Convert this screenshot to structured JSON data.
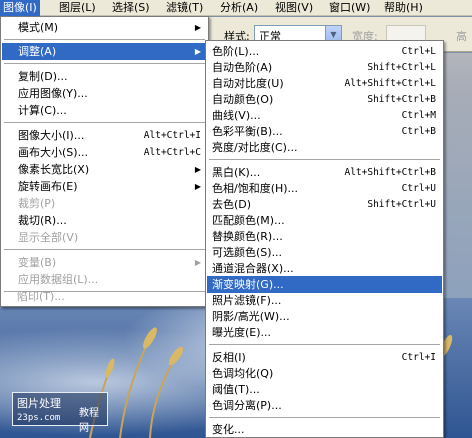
{
  "menubar": {
    "items": [
      "图像(I)",
      "图层(L)",
      "选择(S)",
      "滤镜(T)",
      "分析(A)",
      "视图(V)",
      "窗口(W)",
      "帮助(H)"
    ]
  },
  "options_bar": {
    "style_label": "样式:",
    "style_value": "正常",
    "width_label": "宽度:",
    "height_label": "高"
  },
  "image_menu": {
    "items": [
      {
        "label": "模式(M)",
        "shortcut": "",
        "submenu": true,
        "disabled": false,
        "highlighted": false
      },
      {
        "label": "调整(A)",
        "shortcut": "",
        "submenu": true,
        "disabled": false,
        "highlighted": true
      },
      {
        "label": "复制(D)...",
        "shortcut": "",
        "submenu": false,
        "disabled": false,
        "highlighted": false
      },
      {
        "label": "应用图像(Y)...",
        "shortcut": "",
        "submenu": false,
        "disabled": false,
        "highlighted": false
      },
      {
        "label": "计算(C)...",
        "shortcut": "",
        "submenu": false,
        "disabled": false,
        "highlighted": false
      },
      {
        "label": "图像大小(I)...",
        "shortcut": "Alt+Ctrl+I",
        "submenu": false,
        "disabled": false,
        "highlighted": false
      },
      {
        "label": "画布大小(S)...",
        "shortcut": "Alt+Ctrl+C",
        "submenu": false,
        "disabled": false,
        "highlighted": false
      },
      {
        "label": "像素长宽比(X)",
        "shortcut": "",
        "submenu": true,
        "disabled": false,
        "highlighted": false
      },
      {
        "label": "旋转画布(E)",
        "shortcut": "",
        "submenu": true,
        "disabled": false,
        "highlighted": false
      },
      {
        "label": "裁剪(P)",
        "shortcut": "",
        "submenu": false,
        "disabled": true,
        "highlighted": false
      },
      {
        "label": "裁切(R)...",
        "shortcut": "",
        "submenu": false,
        "disabled": false,
        "highlighted": false
      },
      {
        "label": "显示全部(V)",
        "shortcut": "",
        "submenu": false,
        "disabled": true,
        "highlighted": false
      },
      {
        "label": "变量(B)",
        "shortcut": "",
        "submenu": true,
        "disabled": true,
        "highlighted": false
      },
      {
        "label": "应用数据组(L)...",
        "shortcut": "",
        "submenu": false,
        "disabled": true,
        "highlighted": false
      },
      {
        "label": "陷印(T)...",
        "shortcut": "",
        "submenu": false,
        "disabled": true,
        "highlighted": false
      }
    ]
  },
  "adjust_menu": {
    "items": [
      {
        "label": "色阶(L)...",
        "shortcut": "Ctrl+L",
        "highlighted": false
      },
      {
        "label": "自动色阶(A)",
        "shortcut": "Shift+Ctrl+L",
        "highlighted": false
      },
      {
        "label": "自动对比度(U)",
        "shortcut": "Alt+Shift+Ctrl+L",
        "highlighted": false
      },
      {
        "label": "自动颜色(O)",
        "shortcut": "Shift+Ctrl+B",
        "highlighted": false
      },
      {
        "label": "曲线(V)...",
        "shortcut": "Ctrl+M",
        "highlighted": false
      },
      {
        "label": "色彩平衡(B)...",
        "shortcut": "Ctrl+B",
        "highlighted": false
      },
      {
        "label": "亮度/对比度(C)...",
        "shortcut": "",
        "highlighted": false
      },
      {
        "label": "黑白(K)...",
        "shortcut": "Alt+Shift+Ctrl+B",
        "highlighted": false
      },
      {
        "label": "色相/饱和度(H)...",
        "shortcut": "Ctrl+U",
        "highlighted": false
      },
      {
        "label": "去色(D)",
        "shortcut": "Shift+Ctrl+U",
        "highlighted": false
      },
      {
        "label": "匹配颜色(M)...",
        "shortcut": "",
        "highlighted": false
      },
      {
        "label": "替换颜色(R)...",
        "shortcut": "",
        "highlighted": false
      },
      {
        "label": "可选颜色(S)...",
        "shortcut": "",
        "highlighted": false
      },
      {
        "label": "通道混合器(X)...",
        "shortcut": "",
        "highlighted": false
      },
      {
        "label": "渐变映射(G)...",
        "shortcut": "",
        "highlighted": true
      },
      {
        "label": "照片滤镜(F)...",
        "shortcut": "",
        "highlighted": false
      },
      {
        "label": "阴影/高光(W)...",
        "shortcut": "",
        "highlighted": false
      },
      {
        "label": "曝光度(E)...",
        "shortcut": "",
        "highlighted": false
      },
      {
        "label": "反相(I)",
        "shortcut": "Ctrl+I",
        "highlighted": false
      },
      {
        "label": "色调均化(Q)",
        "shortcut": "",
        "highlighted": false
      },
      {
        "label": "阈值(T)...",
        "shortcut": "",
        "highlighted": false
      },
      {
        "label": "色调分离(P)...",
        "shortcut": "",
        "highlighted": false
      },
      {
        "label": "变化...",
        "shortcut": "",
        "highlighted": false
      }
    ]
  },
  "watermark": {
    "line1": "图片处理",
    "line2": "教程网",
    "url": "23ps.com"
  },
  "colors": {
    "highlight": "#316ac5",
    "menu_bg": "#ffffff",
    "chrome": "#ece9d8",
    "disabled_text": "#a0a0a0"
  },
  "icons": {
    "submenu_arrow": "triangle-right-icon",
    "dropdown_arrow": "chevron-down-icon"
  }
}
